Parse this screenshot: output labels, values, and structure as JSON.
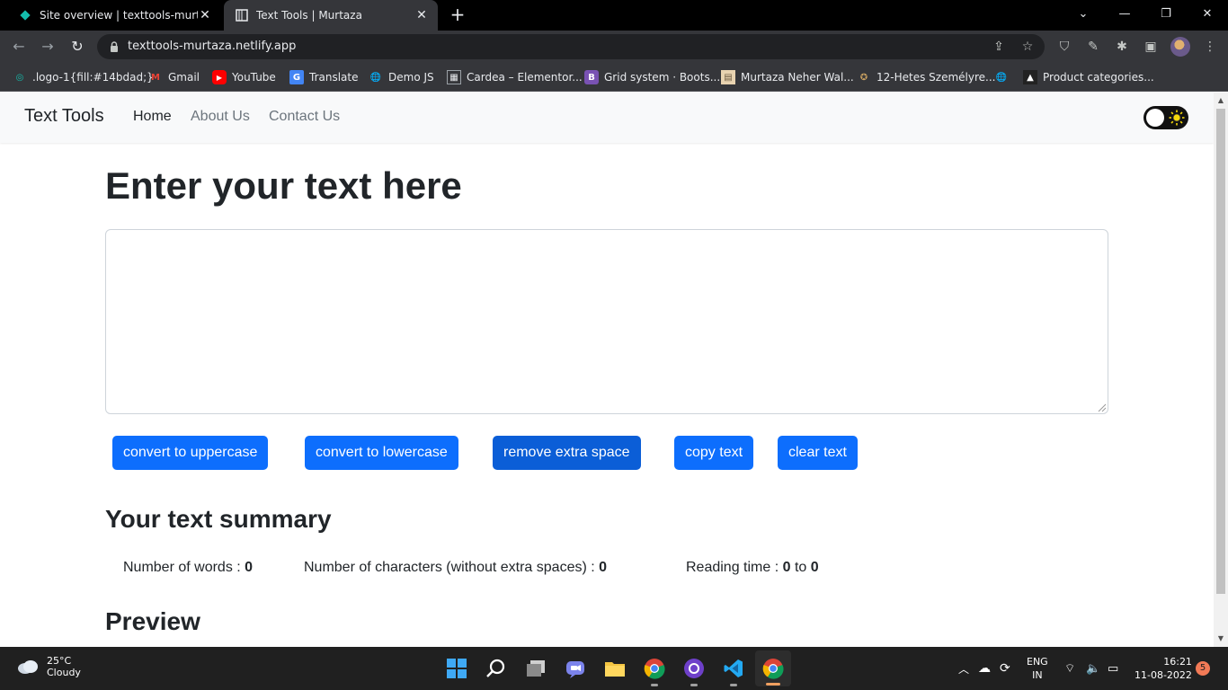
{
  "browser": {
    "tabs": [
      {
        "title": "Site overview | texttools-murtaza",
        "favicon": "netlify-diamond-icon"
      },
      {
        "title": "Text Tools | Murtaza",
        "favicon": "page-icon"
      }
    ],
    "url": "texttools-murtaza.netlify.app",
    "bookmarks": [
      {
        "label": ".logo-1{fill:#14bdad;}",
        "icon": "circle-logo-icon"
      },
      {
        "label": "Gmail",
        "icon": "gmail-icon"
      },
      {
        "label": "YouTube",
        "icon": "youtube-icon"
      },
      {
        "label": "Translate",
        "icon": "translate-icon"
      },
      {
        "label": "Demo JS",
        "icon": "globe-icon"
      },
      {
        "label": "Cardea – Elementor...",
        "icon": "grid-icon"
      },
      {
        "label": "Grid system · Boots...",
        "icon": "bootstrap-icon"
      },
      {
        "label": "Murtaza Neher Wal...",
        "icon": "doc-icon"
      },
      {
        "label": "12-Hetes Személyre...",
        "icon": "badge-icon"
      },
      {
        "label": "",
        "icon": "globe-icon"
      },
      {
        "label": "Product categories...",
        "icon": "triangle-icon"
      }
    ]
  },
  "app": {
    "brand": "Text Tools",
    "nav": [
      "Home",
      "About Us",
      "Contact Us"
    ],
    "heading": "Enter your text here",
    "textarea_value": "",
    "buttons": [
      "convert to uppercase",
      "convert to lowercase",
      "remove extra space",
      "copy text",
      "clear text"
    ],
    "summary_title": "Your text summary",
    "stats": {
      "words_label": "Number of words : ",
      "words_value": "0",
      "chars_label": "Number of characters (without extra spaces) : ",
      "chars_value": "0",
      "reading_label": "Reading time : ",
      "reading_min": "0",
      "reading_to": " to ",
      "reading_max": "0"
    },
    "preview_title": "Preview",
    "accent": "#0d6efd"
  },
  "taskbar": {
    "temperature": "25°C",
    "weather": "Cloudy",
    "language": "ENG",
    "region": "IN",
    "time": "16:21",
    "date": "11-08-2022",
    "notifications": "5"
  }
}
